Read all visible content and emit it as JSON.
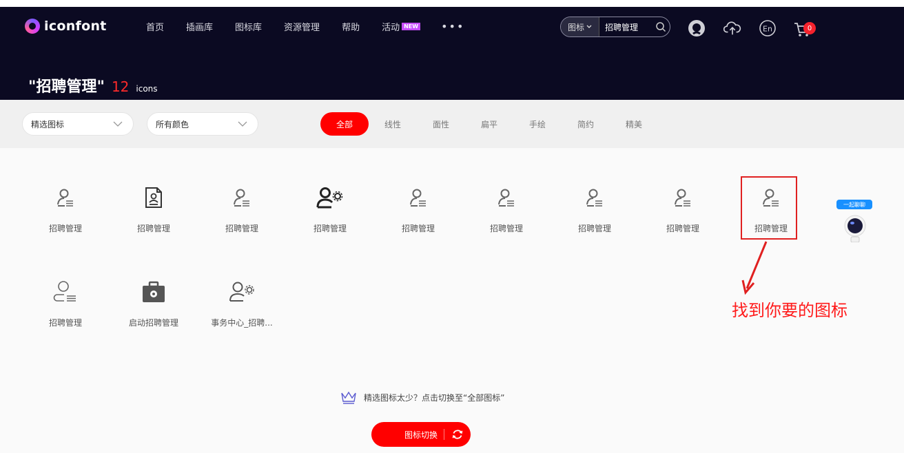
{
  "brand": {
    "logo_text": "iconfont"
  },
  "nav": {
    "items": [
      "首页",
      "插画库",
      "图标库",
      "资源管理",
      "帮助",
      "活动"
    ],
    "new_badge": "NEW",
    "more": "•••"
  },
  "search": {
    "type_label": "图标",
    "value": "招聘管理"
  },
  "header_icons": [
    "github-icon",
    "upload-cloud-icon",
    "language-en-icon",
    "cart-icon"
  ],
  "lang_label": "En",
  "cart": {
    "count": "0"
  },
  "page_title": {
    "query": "\"招聘管理\"",
    "count": "12",
    "unit": "icons"
  },
  "filters": {
    "select_type": "精选图标",
    "select_color": "所有颜色",
    "tabs": [
      "全部",
      "线性",
      "面性",
      "扁平",
      "手绘",
      "简约",
      "精美"
    ],
    "active_tab": "全部"
  },
  "icons": [
    {
      "label": "招聘管理",
      "glyph": "user-list-icon"
    },
    {
      "label": "招聘管理",
      "glyph": "resume-doc-icon"
    },
    {
      "label": "招聘管理",
      "glyph": "user-list-icon"
    },
    {
      "label": "招聘管理",
      "glyph": "user-gear-icon"
    },
    {
      "label": "招聘管理",
      "glyph": "user-list-icon"
    },
    {
      "label": "招聘管理",
      "glyph": "user-list-icon"
    },
    {
      "label": "招聘管理",
      "glyph": "user-list-icon"
    },
    {
      "label": "招聘管理",
      "glyph": "user-list-icon"
    },
    {
      "label": "招聘管理",
      "glyph": "user-list-icon"
    },
    {
      "label": "招聘管理",
      "glyph": "user-list-outline-icon"
    },
    {
      "label": "启动招聘管理",
      "glyph": "briefcase-gear-icon"
    },
    {
      "label": "事务中心_招聘...",
      "glyph": "user-gear-outline-icon"
    }
  ],
  "annotation": {
    "text": "找到你要的图标"
  },
  "mascot": {
    "bubble": "一起聊聊"
  },
  "hint": {
    "text": "精选图标太少？点击切换至“全部图标”"
  },
  "switch_button": {
    "label": "图标切换"
  },
  "colors": {
    "header_bg": "#0b0a22",
    "accent": "#ff0000",
    "new_badge": "#c64dff"
  }
}
